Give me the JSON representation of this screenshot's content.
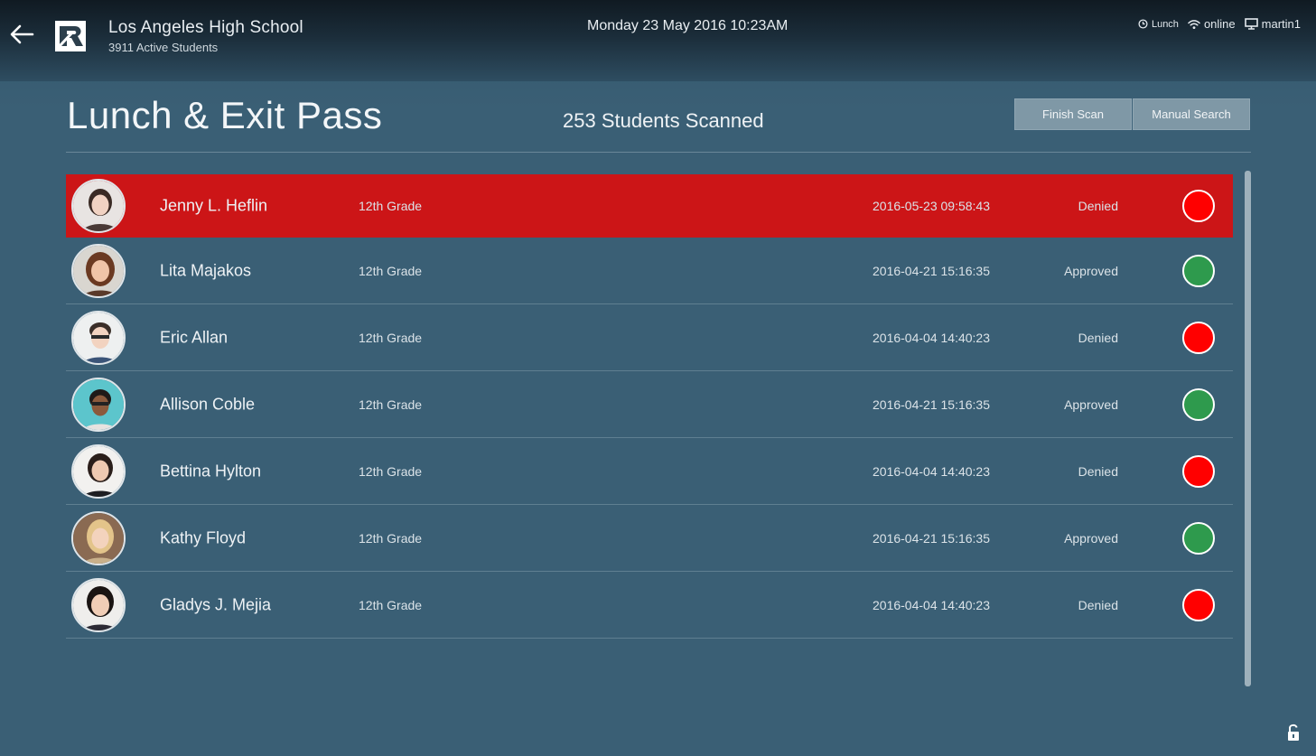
{
  "header": {
    "back_icon": "arrow-left-icon",
    "logo_icon": "r-logo-icon",
    "school_name": "Los Angeles High School",
    "school_sub": "3911 Active Students",
    "datetime": "Monday 23 May 2016 10:23AM",
    "status": {
      "lunch_icon": "clock-icon",
      "lunch_label": "Lunch",
      "wifi_icon": "wifi-icon",
      "online_label": "online",
      "monitor_icon": "monitor-icon",
      "user_label": "martin1"
    }
  },
  "page": {
    "title": "Lunch & Exit Pass",
    "scan_count": "253 Students Scanned",
    "finish_label": "Finish Scan",
    "manual_label": "Manual Search"
  },
  "colors": {
    "highlight_row": "#cc1517",
    "denied": "#ff0000",
    "approved": "#2e9a4d"
  },
  "students": [
    {
      "name": "Jenny L. Heflin",
      "grade": "12th Grade",
      "timestamp": "2016-05-23 09:58:43",
      "result": "Denied",
      "status": "denied",
      "highlight": true
    },
    {
      "name": "Lita Majakos",
      "grade": "12th Grade",
      "timestamp": "2016-04-21 15:16:35",
      "result": "Approved",
      "status": "approved",
      "highlight": false
    },
    {
      "name": "Eric Allan",
      "grade": "12th Grade",
      "timestamp": "2016-04-04 14:40:23",
      "result": "Denied",
      "status": "denied",
      "highlight": false
    },
    {
      "name": "Allison Coble",
      "grade": "12th Grade",
      "timestamp": "2016-04-21 15:16:35",
      "result": "Approved",
      "status": "approved",
      "highlight": false
    },
    {
      "name": "Bettina Hylton",
      "grade": "12th Grade",
      "timestamp": "2016-04-04 14:40:23",
      "result": "Denied",
      "status": "denied",
      "highlight": false
    },
    {
      "name": "Kathy Floyd",
      "grade": "12th Grade",
      "timestamp": "2016-04-21 15:16:35",
      "result": "Approved",
      "status": "approved",
      "highlight": false
    },
    {
      "name": "Gladys J. Mejia",
      "grade": "12th Grade",
      "timestamp": "2016-04-04 14:40:23",
      "result": "Denied",
      "status": "denied",
      "highlight": false
    }
  ],
  "footer": {
    "lock_icon": "unlock-icon"
  }
}
